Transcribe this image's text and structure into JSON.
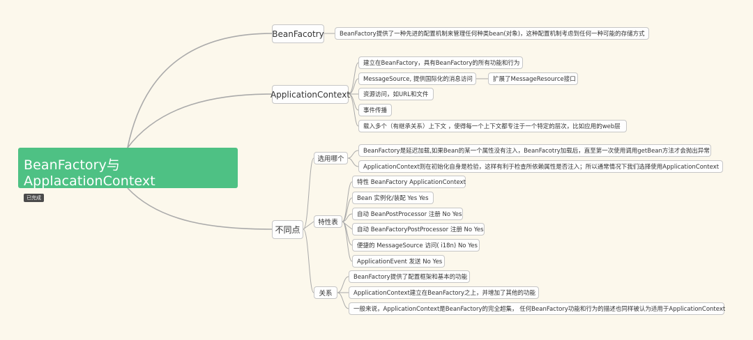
{
  "root": {
    "title": "BeanFactory与ApplacationContext",
    "tag": "已完成"
  },
  "beanfactory": {
    "label": "BeanFacotry",
    "desc": "BeanFactory提供了一种先进的配置机制来管理任何种类bean(对象)，这种配置机制考虑到任何一种可能的存储方式"
  },
  "appcontext": {
    "label": "ApplicationContext",
    "items": [
      "建立在BeanFactory，具有BeanFactory的所有功能和行为",
      "MessageSource, 提供国际化的消息访问",
      "资源访问，如URL和文件",
      "事件传播",
      "载入多个（有继承关系）上下文 ，使得每一个上下文都专注于一个特定的层次，比如应用的web层"
    ],
    "sub": "扩展了MessageResource接口"
  },
  "diff": {
    "label": "不同点",
    "choose": {
      "label": "选用哪个",
      "items": [
        "BeanFactory是延迟加载,如果Bean的某一个属性没有注入，BeanFacotry加载后，直至第一次使用调用getBean方法才会抛出异常",
        "ApplicationContext则在初始化自身是检验，这样有利于检查所依赖属性是否注入；所以通常情况下我们选择使用ApplicationContext"
      ]
    },
    "table": {
      "label": "特性表",
      "items": [
        "特性 BeanFactory ApplicationContext",
        "Bean 实例化/装配 Yes Yes",
        "自动 BeanPostProcessor 注册 No Yes",
        "自动 BeanFactoryPostProcessor 注册 No Yes",
        "便捷的 MessageSource 访问( i18n) No Yes",
        "ApplicationEvent 发送 No Yes"
      ]
    },
    "relation": {
      "label": "关系",
      "items": [
        "BeanFactory提供了配置框架和基本的功能",
        "ApplicationContext建立在BeanFactory之上，并增加了其他的功能",
        "一般来说，ApplicationContext是BeanFactory的完全超集， 任何BeanFactory功能和行为的描述也同样被认为适用于ApplicationContext"
      ]
    }
  }
}
